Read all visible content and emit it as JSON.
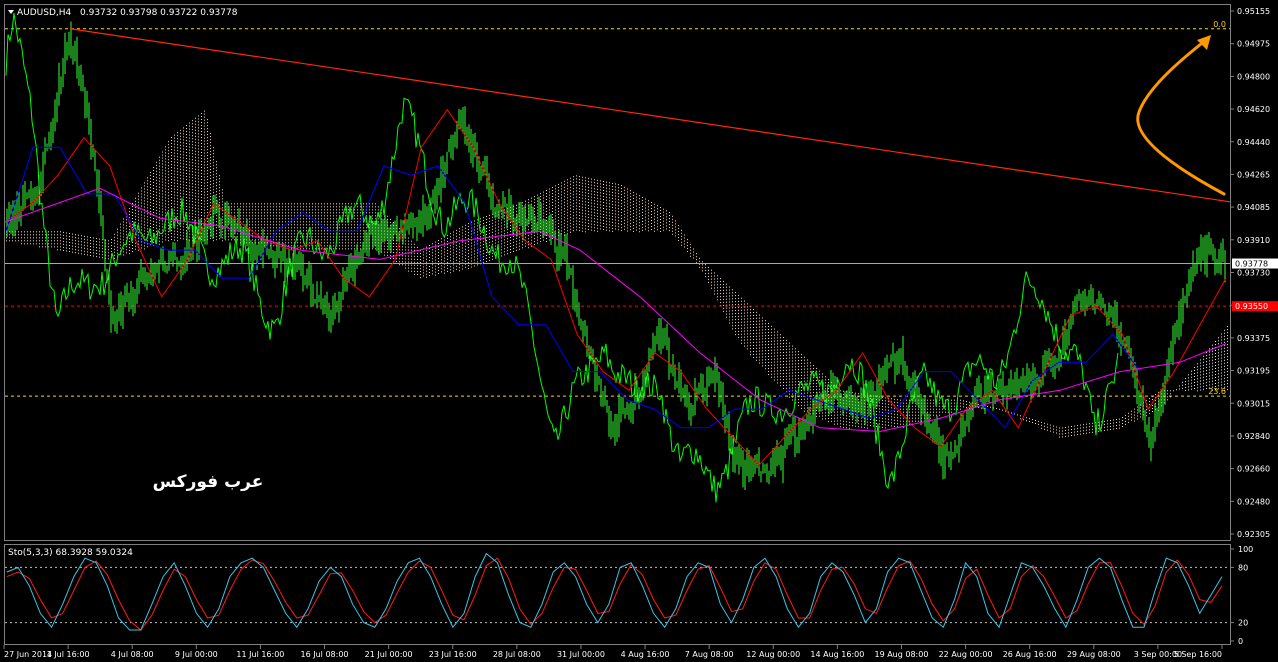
{
  "window": {
    "title": "AUDUSD,H4",
    "ohlc": "0.93732 0.93798 0.93722 0.93778"
  },
  "watermark": "عرب فوركس",
  "colors": {
    "background": "#000000",
    "frame": "#808080",
    "candles": "#33ff33",
    "chikou": "#00ff00",
    "tenkan": "#ff0000",
    "kijun": "#0000ff",
    "ma": "#ff00ff",
    "trendline": "#ff2a00",
    "arrow": "#ff9900",
    "level_line": "#ffd700",
    "stoch_main": "#39c6e6",
    "stoch_signal": "#ff1a1a",
    "price_line": "#9aa9c9"
  },
  "chart_data": [
    {
      "type": "candlestick",
      "symbol": "AUDUSD",
      "timeframe": "H4",
      "ylim": [
        0.923,
        0.9516
      ],
      "y_ticks": [
        "0.95155",
        "0.94975",
        "0.94800",
        "0.94620",
        "0.94440",
        "0.94265",
        "0.94085",
        "0.93910",
        "0.93730",
        "0.93550",
        "0.93375",
        "0.93195",
        "0.93015",
        "0.92840",
        "0.92660",
        "0.92480",
        "0.92305"
      ],
      "x_ticks": [
        "27 Jun 2014",
        "1 Jul 16:00",
        "4 Jul 08:00",
        "9 Jul 00:00",
        "11 Jul 16:00",
        "16 Jul 08:00",
        "21 Jul 00:00",
        "23 Jul 16:00",
        "28 Jul 08:00",
        "31 Jul 00:00",
        "4 Aug 16:00",
        "7 Aug 08:00",
        "12 Aug 00:00",
        "14 Aug 16:00",
        "19 Aug 08:00",
        "22 Aug 00:00",
        "26 Aug 16:00",
        "29 Aug 08:00",
        "3 Sep 00:00",
        "5 Sep 16:00"
      ],
      "current_price": "0.93778",
      "marked_price": "0.93550",
      "fib_levels": [
        {
          "label": "0.0",
          "price": 0.95033
        },
        {
          "label": "23.6",
          "price": 0.93069
        }
      ],
      "trendline": {
        "from": 0.95033,
        "to": 0.94108
      },
      "tenkan_sen": [
        0.94,
        0.941,
        0.9425,
        0.9445,
        0.943,
        0.939,
        0.936,
        0.938,
        0.941,
        0.94,
        0.939,
        0.9385,
        0.939,
        0.937,
        0.936,
        0.938,
        0.944,
        0.946,
        0.944,
        0.941,
        0.939,
        0.938,
        0.934,
        0.932,
        0.931,
        0.933,
        0.932,
        0.93,
        0.9285,
        0.927,
        0.9285,
        0.93,
        0.931,
        0.933,
        0.9305,
        0.929,
        0.928,
        0.93,
        0.931,
        0.929,
        0.932,
        0.935,
        0.9355,
        0.934,
        0.93,
        0.932,
        0.9345,
        0.937
      ],
      "kijun_sen": [
        0.9395,
        0.944,
        0.944,
        0.9415,
        0.9415,
        0.939,
        0.9385,
        0.9385,
        0.937,
        0.937,
        0.9395,
        0.9405,
        0.9395,
        0.9395,
        0.943,
        0.9425,
        0.943,
        0.941,
        0.936,
        0.9345,
        0.9345,
        0.932,
        0.932,
        0.9305,
        0.93,
        0.929,
        0.929,
        0.93,
        0.93,
        0.931,
        0.9305,
        0.93,
        0.9295,
        0.93,
        0.932,
        0.932,
        0.9305,
        0.929,
        0.9315,
        0.9325,
        0.9325,
        0.934,
        0.932
      ]
    },
    {
      "type": "line",
      "title": "Sto(5,3,3) 68.3928 59.0324",
      "ylim": [
        0,
        100
      ],
      "y_ticks": [
        "100",
        "80",
        "20",
        "0"
      ],
      "series": [
        {
          "name": "main",
          "values": [
            75,
            80,
            60,
            30,
            15,
            40,
            70,
            90,
            85,
            60,
            25,
            12,
            12,
            40,
            70,
            85,
            60,
            30,
            15,
            35,
            70,
            85,
            90,
            80,
            55,
            30,
            15,
            35,
            65,
            80,
            70,
            40,
            20,
            15,
            35,
            65,
            85,
            90,
            70,
            40,
            15,
            30,
            70,
            95,
            85,
            50,
            20,
            15,
            40,
            75,
            85,
            70,
            40,
            20,
            40,
            80,
            85,
            60,
            30,
            15,
            35,
            70,
            85,
            80,
            40,
            20,
            45,
            80,
            90,
            70,
            35,
            15,
            30,
            70,
            85,
            75,
            50,
            20,
            35,
            75,
            90,
            85,
            55,
            25,
            15,
            45,
            85,
            70,
            30,
            15,
            50,
            85,
            80,
            60,
            35,
            15,
            45,
            80,
            90,
            80,
            45,
            15,
            15,
            55,
            90,
            85,
            60,
            30,
            50,
            70
          ]
        },
        {
          "name": "signal",
          "values": [
            70,
            75,
            68,
            45,
            25,
            30,
            55,
            80,
            87,
            72,
            45,
            22,
            12,
            28,
            55,
            78,
            70,
            45,
            25,
            28,
            55,
            78,
            88,
            84,
            65,
            42,
            25,
            28,
            50,
            73,
            74,
            55,
            32,
            20,
            28,
            52,
            75,
            87,
            80,
            55,
            28,
            23,
            50,
            82,
            90,
            68,
            35,
            18,
            30,
            58,
            80,
            78,
            55,
            30,
            32,
            62,
            83,
            72,
            45,
            25,
            28,
            55,
            78,
            82,
            58,
            32,
            35,
            65,
            85,
            78,
            50,
            25,
            25,
            55,
            78,
            80,
            62,
            35,
            30,
            58,
            82,
            87,
            68,
            40,
            22,
            35,
            68,
            78,
            50,
            25,
            35,
            70,
            82,
            70,
            48,
            25,
            33,
            62,
            85,
            85,
            60,
            30,
            18,
            38,
            75,
            88,
            72,
            45,
            42,
            60
          ]
        }
      ]
    }
  ]
}
